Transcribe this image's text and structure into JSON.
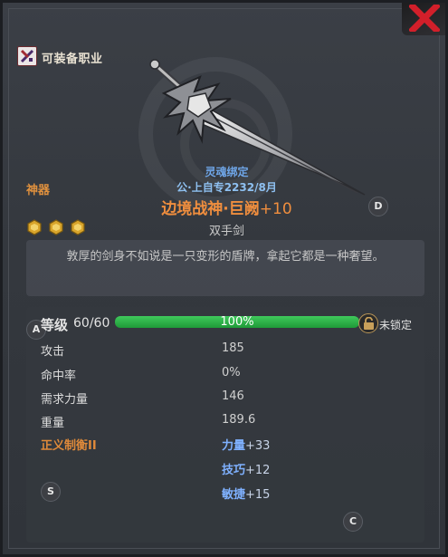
{
  "header": {
    "job_label": "可装备职业",
    "close_icon": "close-x-icon"
  },
  "item": {
    "rarity": "神器",
    "bind": "灵魂绑定",
    "custom": "公·上自专2232/8月",
    "name": "边境战神·巨阙",
    "enhance": "+10",
    "type": "双手剑",
    "description": "敦厚的剑身不如说是一只变形的盾牌，拿起它都是一种奢望。"
  },
  "markers": {
    "a": "A",
    "c": "C",
    "d": "D",
    "s": "S"
  },
  "stats": {
    "level_label": "等级",
    "level_value": "60/60",
    "durability_pct": "100%",
    "durability_fill": 1.0,
    "lock_label": "未锁定",
    "rows": [
      {
        "label": "攻击",
        "value": "185"
      },
      {
        "label": "命中率",
        "value": "0%"
      },
      {
        "label": "需求力量",
        "value": "146"
      },
      {
        "label": "重量",
        "value": "189.6"
      }
    ],
    "set_label": "正义制衡II",
    "bonuses": [
      {
        "name": "力量",
        "value": "+33"
      },
      {
        "name": "技巧",
        "value": "+12"
      },
      {
        "name": "敏捷",
        "value": "+15"
      }
    ]
  },
  "colors": {
    "accent_orange": "#f08e3e",
    "bind_blue": "#6fa6e8",
    "bonus_blue": "#7fb1ff",
    "durability_green": "#3fc95b",
    "close_red": "#d21f2a"
  }
}
